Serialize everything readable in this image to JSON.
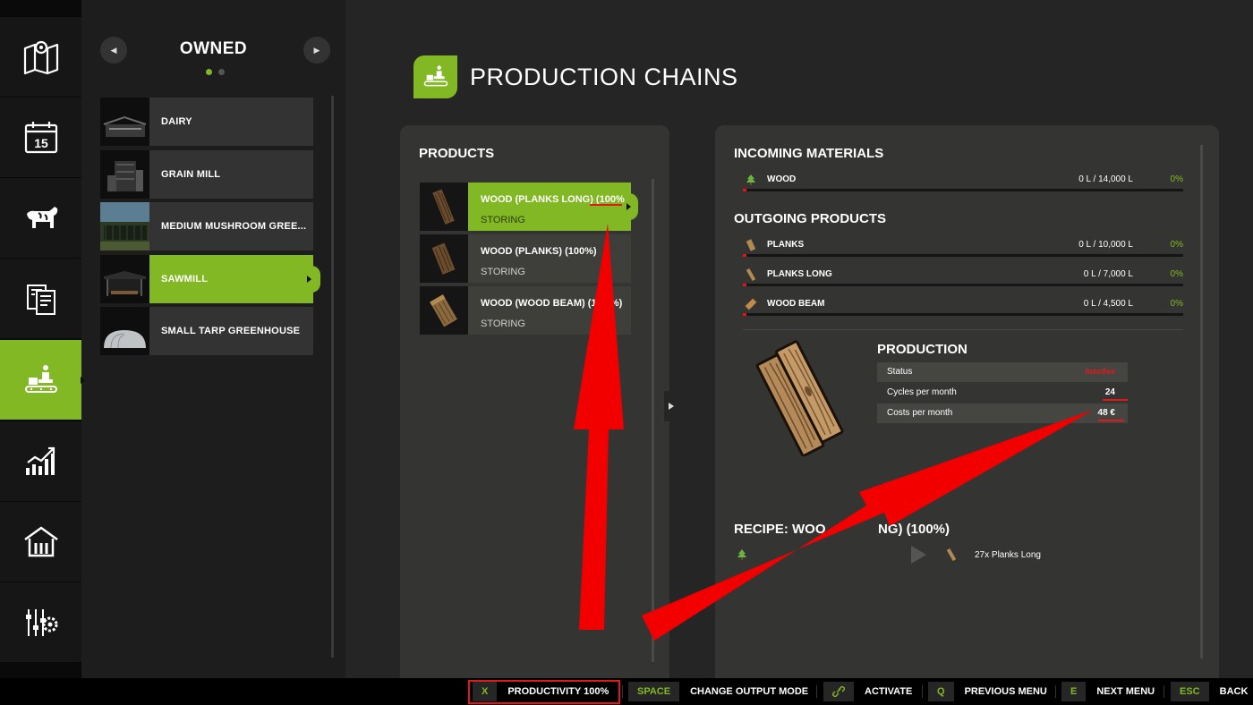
{
  "nav": {
    "items": [
      {
        "icon": "map-icon"
      },
      {
        "icon": "calendar-icon",
        "badge": "15"
      },
      {
        "icon": "livestock-icon"
      },
      {
        "icon": "contracts-icon"
      },
      {
        "icon": "production-icon",
        "active": true
      },
      {
        "icon": "statistics-icon"
      },
      {
        "icon": "finance-icon"
      },
      {
        "icon": "settings-icon"
      }
    ]
  },
  "list": {
    "title": "OWNED",
    "items": [
      {
        "label": "DAIRY"
      },
      {
        "label": "GRAIN MILL"
      },
      {
        "label": "MEDIUM MUSHROOM GREE..."
      },
      {
        "label": "SAWMILL",
        "selected": true
      },
      {
        "label": "SMALL TARP GREENHOUSE"
      }
    ]
  },
  "header": {
    "title": "PRODUCTION CHAINS"
  },
  "products": {
    "heading": "PRODUCTS",
    "items": [
      {
        "name": "WOOD (PLANKS LONG) (100%",
        "mode": "STORING",
        "selected": true
      },
      {
        "name": "WOOD (PLANKS) (100%)",
        "mode": "STORING"
      },
      {
        "name": "WOOD (WOOD BEAM) (1",
        "name_tail": "%)",
        "mode": "STORING"
      }
    ]
  },
  "incoming": {
    "heading": "INCOMING MATERIALS",
    "items": [
      {
        "icon": "tree-icon",
        "name": "WOOD",
        "qty": "0 L / 14,000 L",
        "pct": "0%",
        "fill": 0
      }
    ]
  },
  "outgoing": {
    "heading": "OUTGOING PRODUCTS",
    "items": [
      {
        "icon": "planks-icon",
        "name": "PLANKS",
        "qty": "0 L / 10,000 L",
        "pct": "0%",
        "fill": 0
      },
      {
        "icon": "planks-long-icon",
        "name": "PLANKS LONG",
        "qty": "0 L / 7,000 L",
        "pct": "0%",
        "fill": 0
      },
      {
        "icon": "wood-beam-icon",
        "name": "WOOD BEAM",
        "qty": "0 L / 4,500 L",
        "pct": "0%",
        "fill": 0
      }
    ]
  },
  "production": {
    "heading": "PRODUCTION",
    "status_label": "Status",
    "status_value": "Inactive",
    "cycles_label": "Cycles per month",
    "cycles_value": "24",
    "costs_label": "Costs per month",
    "costs_value": "48 €"
  },
  "recipe": {
    "heading_left": "RECIPE: WOO",
    "heading_right": "NG) (100%)",
    "output": "27x Planks Long"
  },
  "hints": [
    {
      "key": "X",
      "label": "PRODUCTIVITY 100%"
    },
    {
      "key": "SPACE",
      "label": "CHANGE OUTPUT MODE"
    },
    {
      "key": "link-icon",
      "label": "ACTIVATE"
    },
    {
      "key": "Q",
      "label": "PREVIOUS MENU"
    },
    {
      "key": "E",
      "label": "NEXT MENU"
    },
    {
      "key": "ESC",
      "label": "BACK"
    }
  ],
  "colors": {
    "accent": "#82b823",
    "annotation": "#e31818",
    "inactive": "#e31818"
  }
}
